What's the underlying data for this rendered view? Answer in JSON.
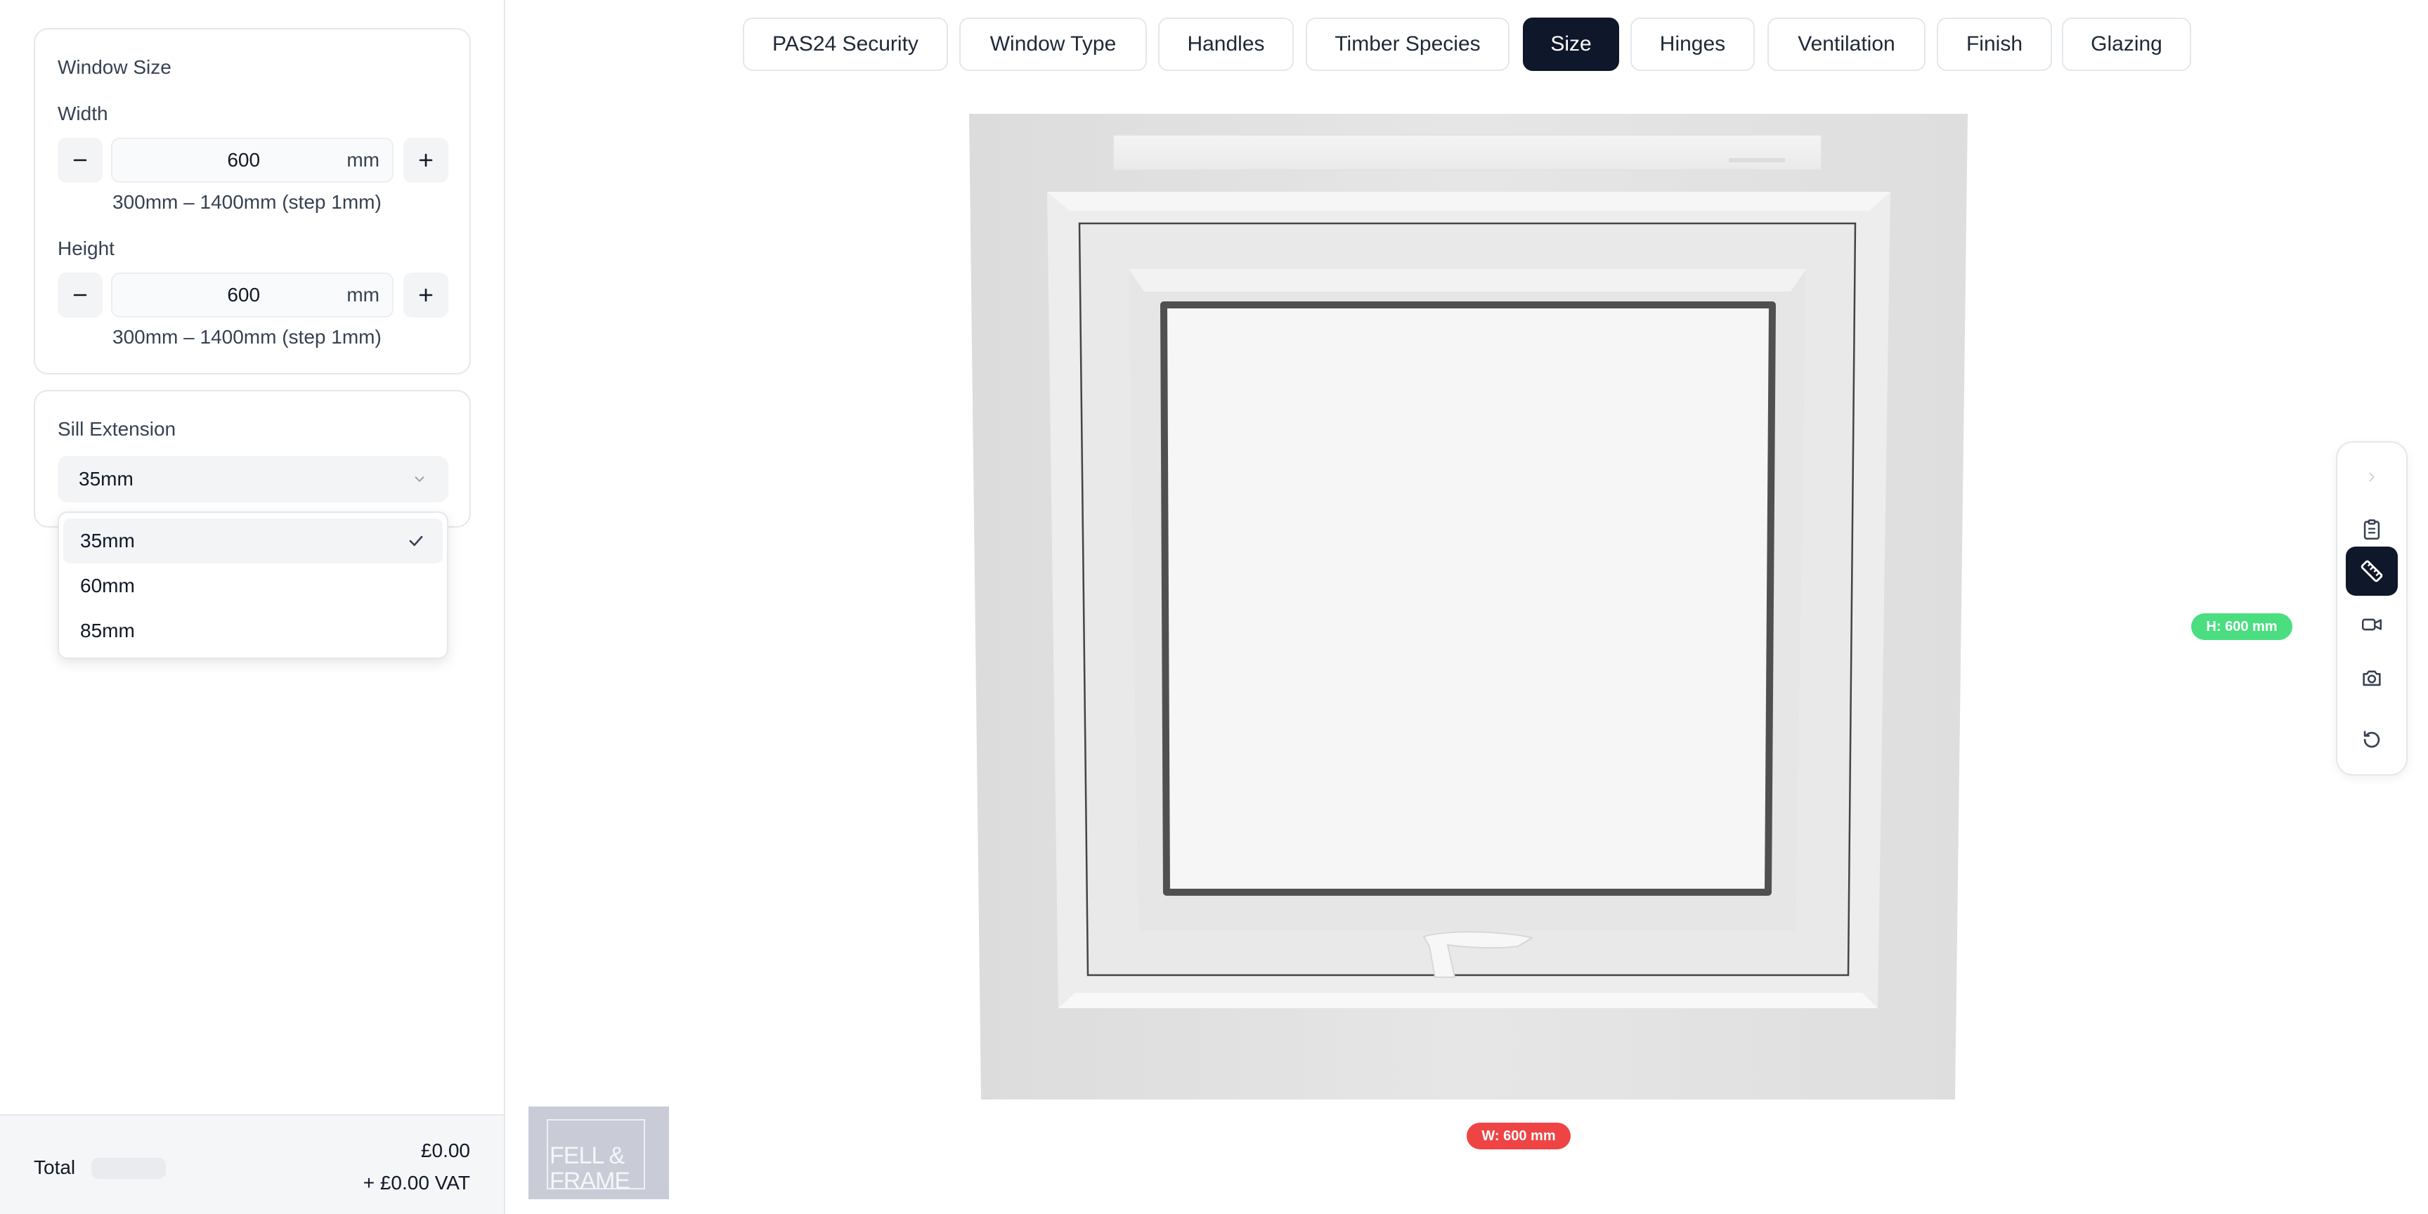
{
  "window_size": {
    "title": "Window Size",
    "width": {
      "label": "Width",
      "value": "600",
      "unit": "mm",
      "hint": "300mm – 1400mm (step 1mm)"
    },
    "height": {
      "label": "Height",
      "value": "600",
      "unit": "mm",
      "hint": "300mm – 1400mm (step 1mm)"
    }
  },
  "sill_extension": {
    "title": "Sill Extension",
    "selected": "35mm",
    "options": [
      "35mm",
      "60mm",
      "85mm"
    ]
  },
  "total": {
    "label": "Total",
    "price": "£0.00",
    "vat": "+ £0.00 VAT"
  },
  "logo": {
    "line1": "FELL &",
    "line2": "FRAME"
  },
  "tabs": [
    {
      "label": "PAS24 Security"
    },
    {
      "label": "Window Type"
    },
    {
      "label": "Handles"
    },
    {
      "label": "Timber Species"
    },
    {
      "label": "Size",
      "active": true
    },
    {
      "label": "Hinges"
    },
    {
      "label": "Ventilation"
    },
    {
      "label": "Finish"
    },
    {
      "label": "Glazing"
    }
  ],
  "dimensions": {
    "height_tag": "H: 600 mm",
    "width_tag": "W: 600 mm"
  },
  "toolbar_icons": [
    "chevron-right-icon",
    "clipboard-icon",
    "ruler-icon",
    "video-camera-icon",
    "camera-icon",
    "reset-icon"
  ],
  "colors": {
    "active": "#0f172a",
    "height_tag": "#4ade80",
    "width_tag": "#ef4444"
  }
}
